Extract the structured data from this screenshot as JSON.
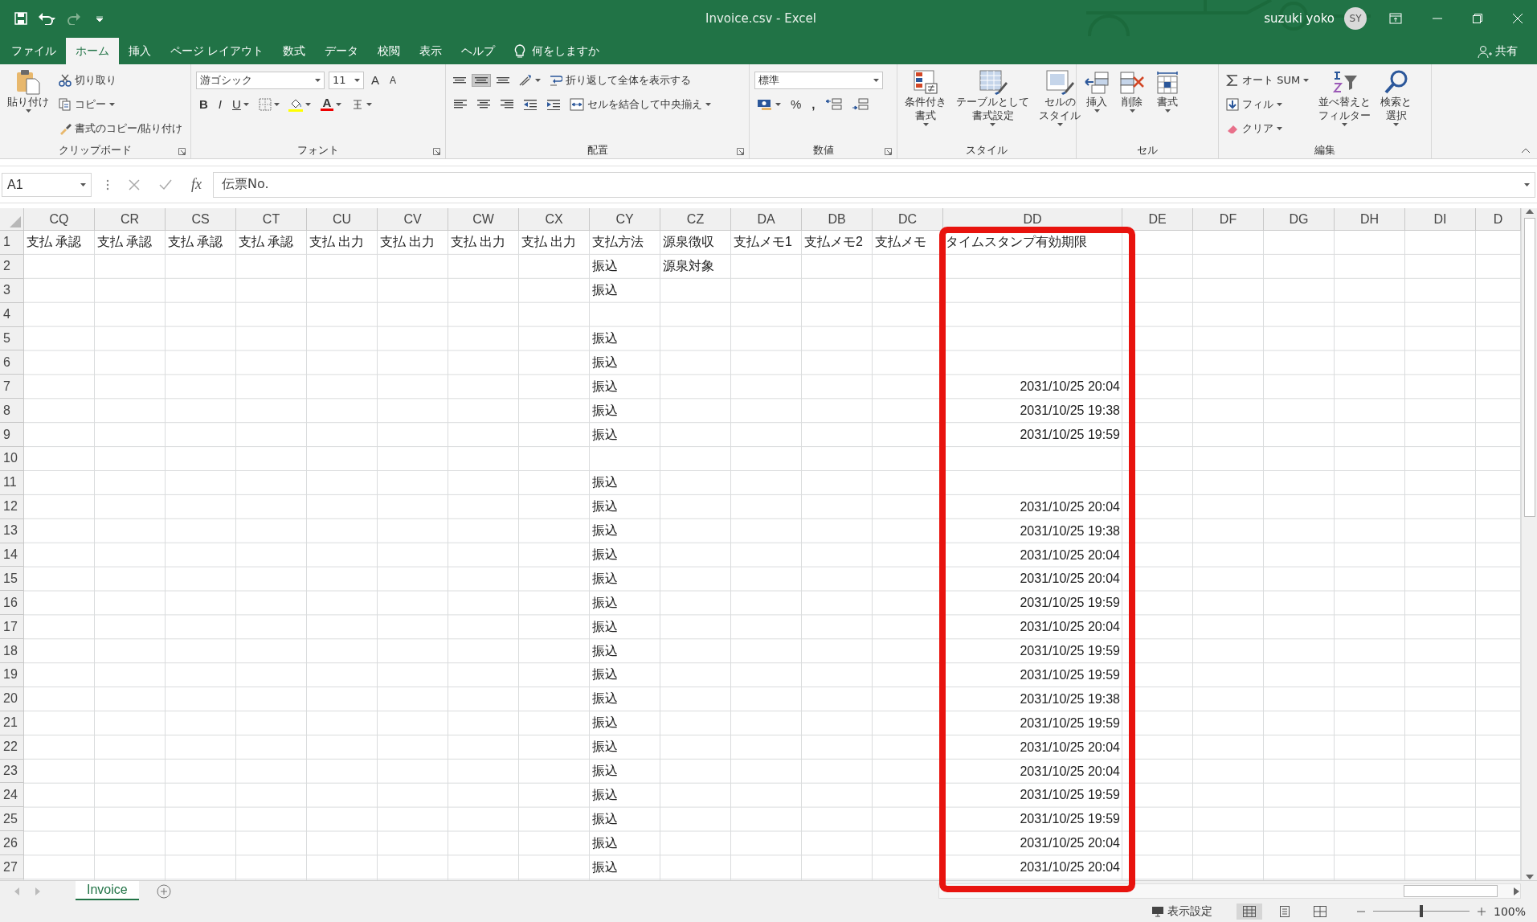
{
  "window": {
    "title": "Invoice.csv  -  Excel",
    "user": "suzuki yoko",
    "avatar": "SY",
    "share": "共有"
  },
  "menu_tabs": [
    {
      "label": "ファイル",
      "selected": false
    },
    {
      "label": "ホーム",
      "selected": true
    },
    {
      "label": "挿入",
      "selected": false
    },
    {
      "label": "ページ レイアウト",
      "selected": false
    },
    {
      "label": "数式",
      "selected": false
    },
    {
      "label": "データ",
      "selected": false
    },
    {
      "label": "校閲",
      "selected": false
    },
    {
      "label": "表示",
      "selected": false
    },
    {
      "label": "ヘルプ",
      "selected": false
    }
  ],
  "tell_me": "何をしますか",
  "ribbon": [
    {
      "label": "クリップボード",
      "launcher": true,
      "columns": [
        {
          "kind": "large",
          "lines": [
            "貼り付け"
          ],
          "has_menu": true
        },
        {
          "kind": "stack",
          "bands": [
            {
              "items": [
                {
                  "kind": "small",
                  "label": "切り取り",
                  "has_menu": false
                }
              ]
            },
            {
              "items": [
                {
                  "kind": "small",
                  "label": "コピー",
                  "has_menu": true
                }
              ]
            },
            {
              "items": [
                {
                  "kind": "small",
                  "label": "書式のコピー/貼り付け",
                  "has_menu": false
                }
              ]
            }
          ]
        }
      ]
    },
    {
      "label": "フォント",
      "launcher": true,
      "columns": [
        {
          "kind": "stack",
          "bands": [
            {
              "items": [
                {
                  "kind": "combo-wide",
                  "value": "游ゴシック"
                },
                {
                  "kind": "combo",
                  "value": "11"
                },
                {
                  "kind": "glyph",
                  "text": "A",
                  "has_menu": false
                },
                {
                  "kind": "glyph-small",
                  "text": "A",
                  "has_menu": false
                }
              ]
            },
            {
              "items": [
                {
                  "kind": "glyph-bold",
                  "text": "B",
                  "has_menu": false
                },
                {
                  "kind": "glyph-italic",
                  "text": "I",
                  "has_menu": false
                },
                {
                  "kind": "glyph-underline",
                  "text": "U",
                  "has_menu": true
                },
                {
                  "kind": "icon",
                  "has_menu": true
                },
                {
                  "kind": "icon",
                  "has_menu": true
                },
                {
                  "kind": "font-color",
                  "text": "A",
                  "has_menu": true
                },
                {
                  "kind": "icon",
                  "has_menu": true
                }
              ]
            }
          ]
        }
      ]
    },
    {
      "label": "配置",
      "launcher": true,
      "columns": [
        {
          "kind": "stack",
          "bands": [
            {
              "items": [
                {
                  "kind": "icon",
                  "has_menu": false,
                  "selected": false
                },
                {
                  "kind": "icon",
                  "has_menu": false,
                  "selected": true
                },
                {
                  "kind": "icon",
                  "has_menu": false,
                  "selected": false
                },
                {
                  "kind": "icon",
                  "has_menu": true
                },
                {
                  "kind": "small",
                  "label": "折り返して全体を表示する",
                  "has_menu": false
                }
              ]
            },
            {
              "items": [
                {
                  "kind": "icon",
                  "has_menu": false,
                  "selected": false
                },
                {
                  "kind": "icon",
                  "has_menu": false,
                  "selected": false
                },
                {
                  "kind": "icon",
                  "has_menu": false,
                  "selected": false
                },
                {
                  "kind": "icon",
                  "has_menu": false
                },
                {
                  "kind": "icon",
                  "has_menu": false
                },
                {
                  "kind": "small",
                  "label": "セルを結合して中央揃え",
                  "has_menu": true
                }
              ]
            }
          ]
        }
      ]
    },
    {
      "label": "数値",
      "launcher": true,
      "columns": [
        {
          "kind": "stack",
          "bands": [
            {
              "items": [
                {
                  "kind": "combo-wide",
                  "value": "標準"
                }
              ]
            },
            {
              "items": [
                {
                  "kind": "icon",
                  "has_menu": true
                },
                {
                  "kind": "glyph",
                  "text": "%",
                  "has_menu": false
                },
                {
                  "kind": "glyph-bold",
                  "text": ",",
                  "has_menu": false
                },
                {
                  "kind": "icon",
                  "has_menu": false
                },
                {
                  "kind": "icon",
                  "has_menu": false
                }
              ]
            }
          ]
        }
      ]
    },
    {
      "label": "スタイル",
      "launcher": false,
      "columns": [
        {
          "kind": "large",
          "lines": [
            "条件付き",
            "書式"
          ],
          "has_menu": true
        },
        {
          "kind": "large",
          "lines": [
            "テーブルとして",
            "書式設定"
          ],
          "has_menu": true
        },
        {
          "kind": "large",
          "lines": [
            "セルの",
            "スタイル"
          ],
          "has_menu": true
        }
      ]
    },
    {
      "label": "セル",
      "launcher": false,
      "columns": [
        {
          "kind": "large",
          "lines": [
            "挿入"
          ],
          "has_menu": true
        },
        {
          "kind": "large",
          "lines": [
            "削除"
          ],
          "has_menu": true
        },
        {
          "kind": "large",
          "lines": [
            "書式"
          ],
          "has_menu": true
        }
      ]
    },
    {
      "label": "編集",
      "launcher": false,
      "columns": [
        {
          "kind": "stack",
          "bands": [
            {
              "items": [
                {
                  "kind": "small",
                  "label": "オート SUM",
                  "has_menu": true
                }
              ]
            },
            {
              "items": [
                {
                  "kind": "small",
                  "label": "フィル",
                  "has_menu": true
                }
              ]
            },
            {
              "items": [
                {
                  "kind": "small",
                  "label": "クリア",
                  "has_menu": true
                }
              ]
            }
          ]
        },
        {
          "kind": "large",
          "lines": [
            "並べ替えと",
            "フィルター"
          ],
          "has_menu": true
        },
        {
          "kind": "large",
          "lines": [
            "検索と",
            "選択"
          ],
          "has_menu": true
        }
      ]
    }
  ],
  "formula_bar": {
    "name_box": "A1",
    "function_symbol": "fx",
    "formula": "伝票No."
  },
  "columns": [
    "CQ",
    "CR",
    "CS",
    "CT",
    "CU",
    "CV",
    "CW",
    "CX",
    "CY",
    "CZ",
    "DA",
    "DB",
    "DC",
    "DD",
    "DE",
    "DF",
    "DG",
    "DH",
    "DI",
    "D"
  ],
  "header_row": {
    "number": "1",
    "cells": [
      "支払 承認",
      "支払 承認",
      "支払 承認",
      "支払 承認",
      "支払 出力",
      "支払 出力",
      "支払 出力",
      "支払 出力",
      "支払方法",
      "源泉徴収",
      "支払メモ1",
      "支払メモ2",
      "支払メモ",
      "タイムスタンプ有効期限"
    ]
  },
  "rows": [
    {
      "number": "2",
      "payment_method": "振込",
      "withholding": "源泉対象"
    },
    {
      "number": "3",
      "payment_method": "振込"
    },
    {
      "number": "4"
    },
    {
      "number": "5",
      "payment_method": "振込"
    },
    {
      "number": "6",
      "payment_method": "振込"
    },
    {
      "number": "7",
      "payment_method": "振込",
      "timestamp_expiry": "2031/10/25 20:04"
    },
    {
      "number": "8",
      "payment_method": "振込",
      "timestamp_expiry": "2031/10/25 19:38"
    },
    {
      "number": "9",
      "payment_method": "振込",
      "timestamp_expiry": "2031/10/25 19:59"
    },
    {
      "number": "10"
    },
    {
      "number": "11",
      "payment_method": "振込"
    },
    {
      "number": "12",
      "payment_method": "振込",
      "timestamp_expiry": "2031/10/25 20:04"
    },
    {
      "number": "13",
      "payment_method": "振込",
      "timestamp_expiry": "2031/10/25 19:38"
    },
    {
      "number": "14",
      "payment_method": "振込",
      "timestamp_expiry": "2031/10/25 20:04"
    },
    {
      "number": "15",
      "payment_method": "振込",
      "timestamp_expiry": "2031/10/25 20:04"
    },
    {
      "number": "16",
      "payment_method": "振込",
      "timestamp_expiry": "2031/10/25 19:59"
    },
    {
      "number": "17",
      "payment_method": "振込",
      "timestamp_expiry": "2031/10/25 20:04"
    },
    {
      "number": "18",
      "payment_method": "振込",
      "timestamp_expiry": "2031/10/25 19:59"
    },
    {
      "number": "19",
      "payment_method": "振込",
      "timestamp_expiry": "2031/10/25 19:59"
    },
    {
      "number": "20",
      "payment_method": "振込",
      "timestamp_expiry": "2031/10/25 19:38"
    },
    {
      "number": "21",
      "payment_method": "振込",
      "timestamp_expiry": "2031/10/25 19:59"
    },
    {
      "number": "22",
      "payment_method": "振込",
      "timestamp_expiry": "2031/10/25 20:04"
    },
    {
      "number": "23",
      "payment_method": "振込",
      "timestamp_expiry": "2031/10/25 20:04"
    },
    {
      "number": "24",
      "payment_method": "振込",
      "timestamp_expiry": "2031/10/25 19:59"
    },
    {
      "number": "25",
      "payment_method": "振込",
      "timestamp_expiry": "2031/10/25 19:59"
    },
    {
      "number": "26",
      "payment_method": "振込",
      "timestamp_expiry": "2031/10/25 20:04"
    },
    {
      "number": "27",
      "payment_method": "振込",
      "timestamp_expiry": "2031/10/25 20:04"
    }
  ],
  "sheet_tabs": [
    {
      "label": "Invoice",
      "selected": true
    }
  ],
  "status_bar": {
    "display_settings": "表示設定",
    "views": [
      {
        "selected": true
      },
      {
        "selected": false
      },
      {
        "selected": false
      }
    ],
    "zoom": {
      "level": 0.5,
      "reading": "100%"
    }
  }
}
